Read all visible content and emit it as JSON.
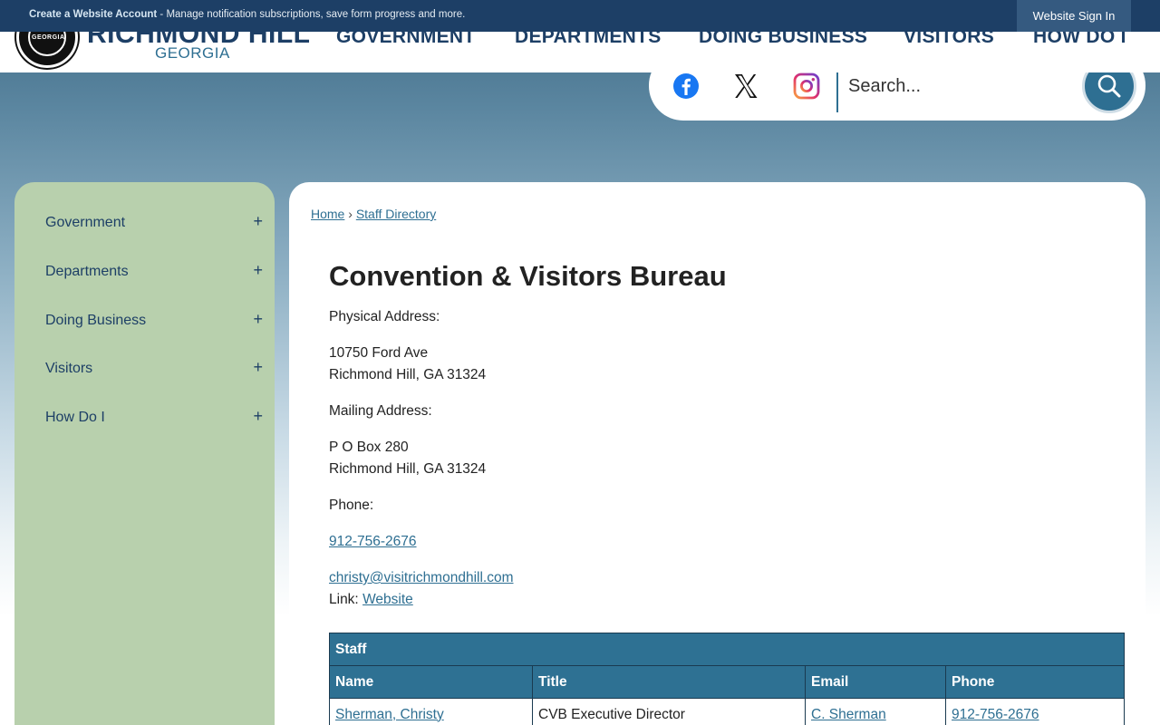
{
  "topbar": {
    "create_account": "Create a Website Account",
    "message": " - Manage notification subscriptions, save form progress and more.",
    "sign_in": "Website Sign In"
  },
  "brand": {
    "name": "RICHMOND HILL",
    "sub": "GEORGIA",
    "seal_text": "GEORGIA"
  },
  "nav": {
    "items": [
      {
        "label": "GOVERNMENT"
      },
      {
        "label": "DEPARTMENTS"
      },
      {
        "label": "DOING BUSINESS"
      },
      {
        "label": "VISITORS"
      },
      {
        "label": "HOW DO I"
      }
    ]
  },
  "social": {
    "icons": [
      "facebook-icon",
      "x-twitter-icon",
      "instagram-icon"
    ]
  },
  "search": {
    "placeholder": "Search...",
    "value": ""
  },
  "sidenav": {
    "items": [
      {
        "label": "Government",
        "toggle": "+"
      },
      {
        "label": "Departments",
        "toggle": "+"
      },
      {
        "label": "Doing Business",
        "toggle": "+"
      },
      {
        "label": "Visitors",
        "toggle": "+"
      },
      {
        "label": "How Do I",
        "toggle": "+"
      }
    ]
  },
  "breadcrumb": {
    "home": "Home",
    "separator": "›",
    "current": "Staff Directory"
  },
  "page": {
    "title": "Convention & Visitors Bureau",
    "physical_label": "Physical Address:",
    "physical_line1": "10750 Ford Ave",
    "physical_line2": "Richmond Hill, GA 31324",
    "mailing_label": "Mailing Address:",
    "mailing_line1": "P O Box 280",
    "mailing_line2": "Richmond Hill, GA 31324",
    "phone_label": "Phone:",
    "phone": "912-756-2676",
    "email": "christy@visitrichmondhill.com",
    "link_label": "Link:",
    "link_text": "Website"
  },
  "staff_table": {
    "caption": "Staff",
    "headers": [
      "Name",
      "Title",
      "Email",
      "Phone"
    ],
    "rows": [
      {
        "name": "Sherman, Christy",
        "title": "CVB Executive Director",
        "email": "C. Sherman",
        "phone": "912-756-2676"
      }
    ]
  },
  "colors": {
    "navy": "#1d3f66",
    "accent": "#2e6f92",
    "sidenav_bg": "#b8d0ad",
    "table_header": "#2e7193"
  }
}
